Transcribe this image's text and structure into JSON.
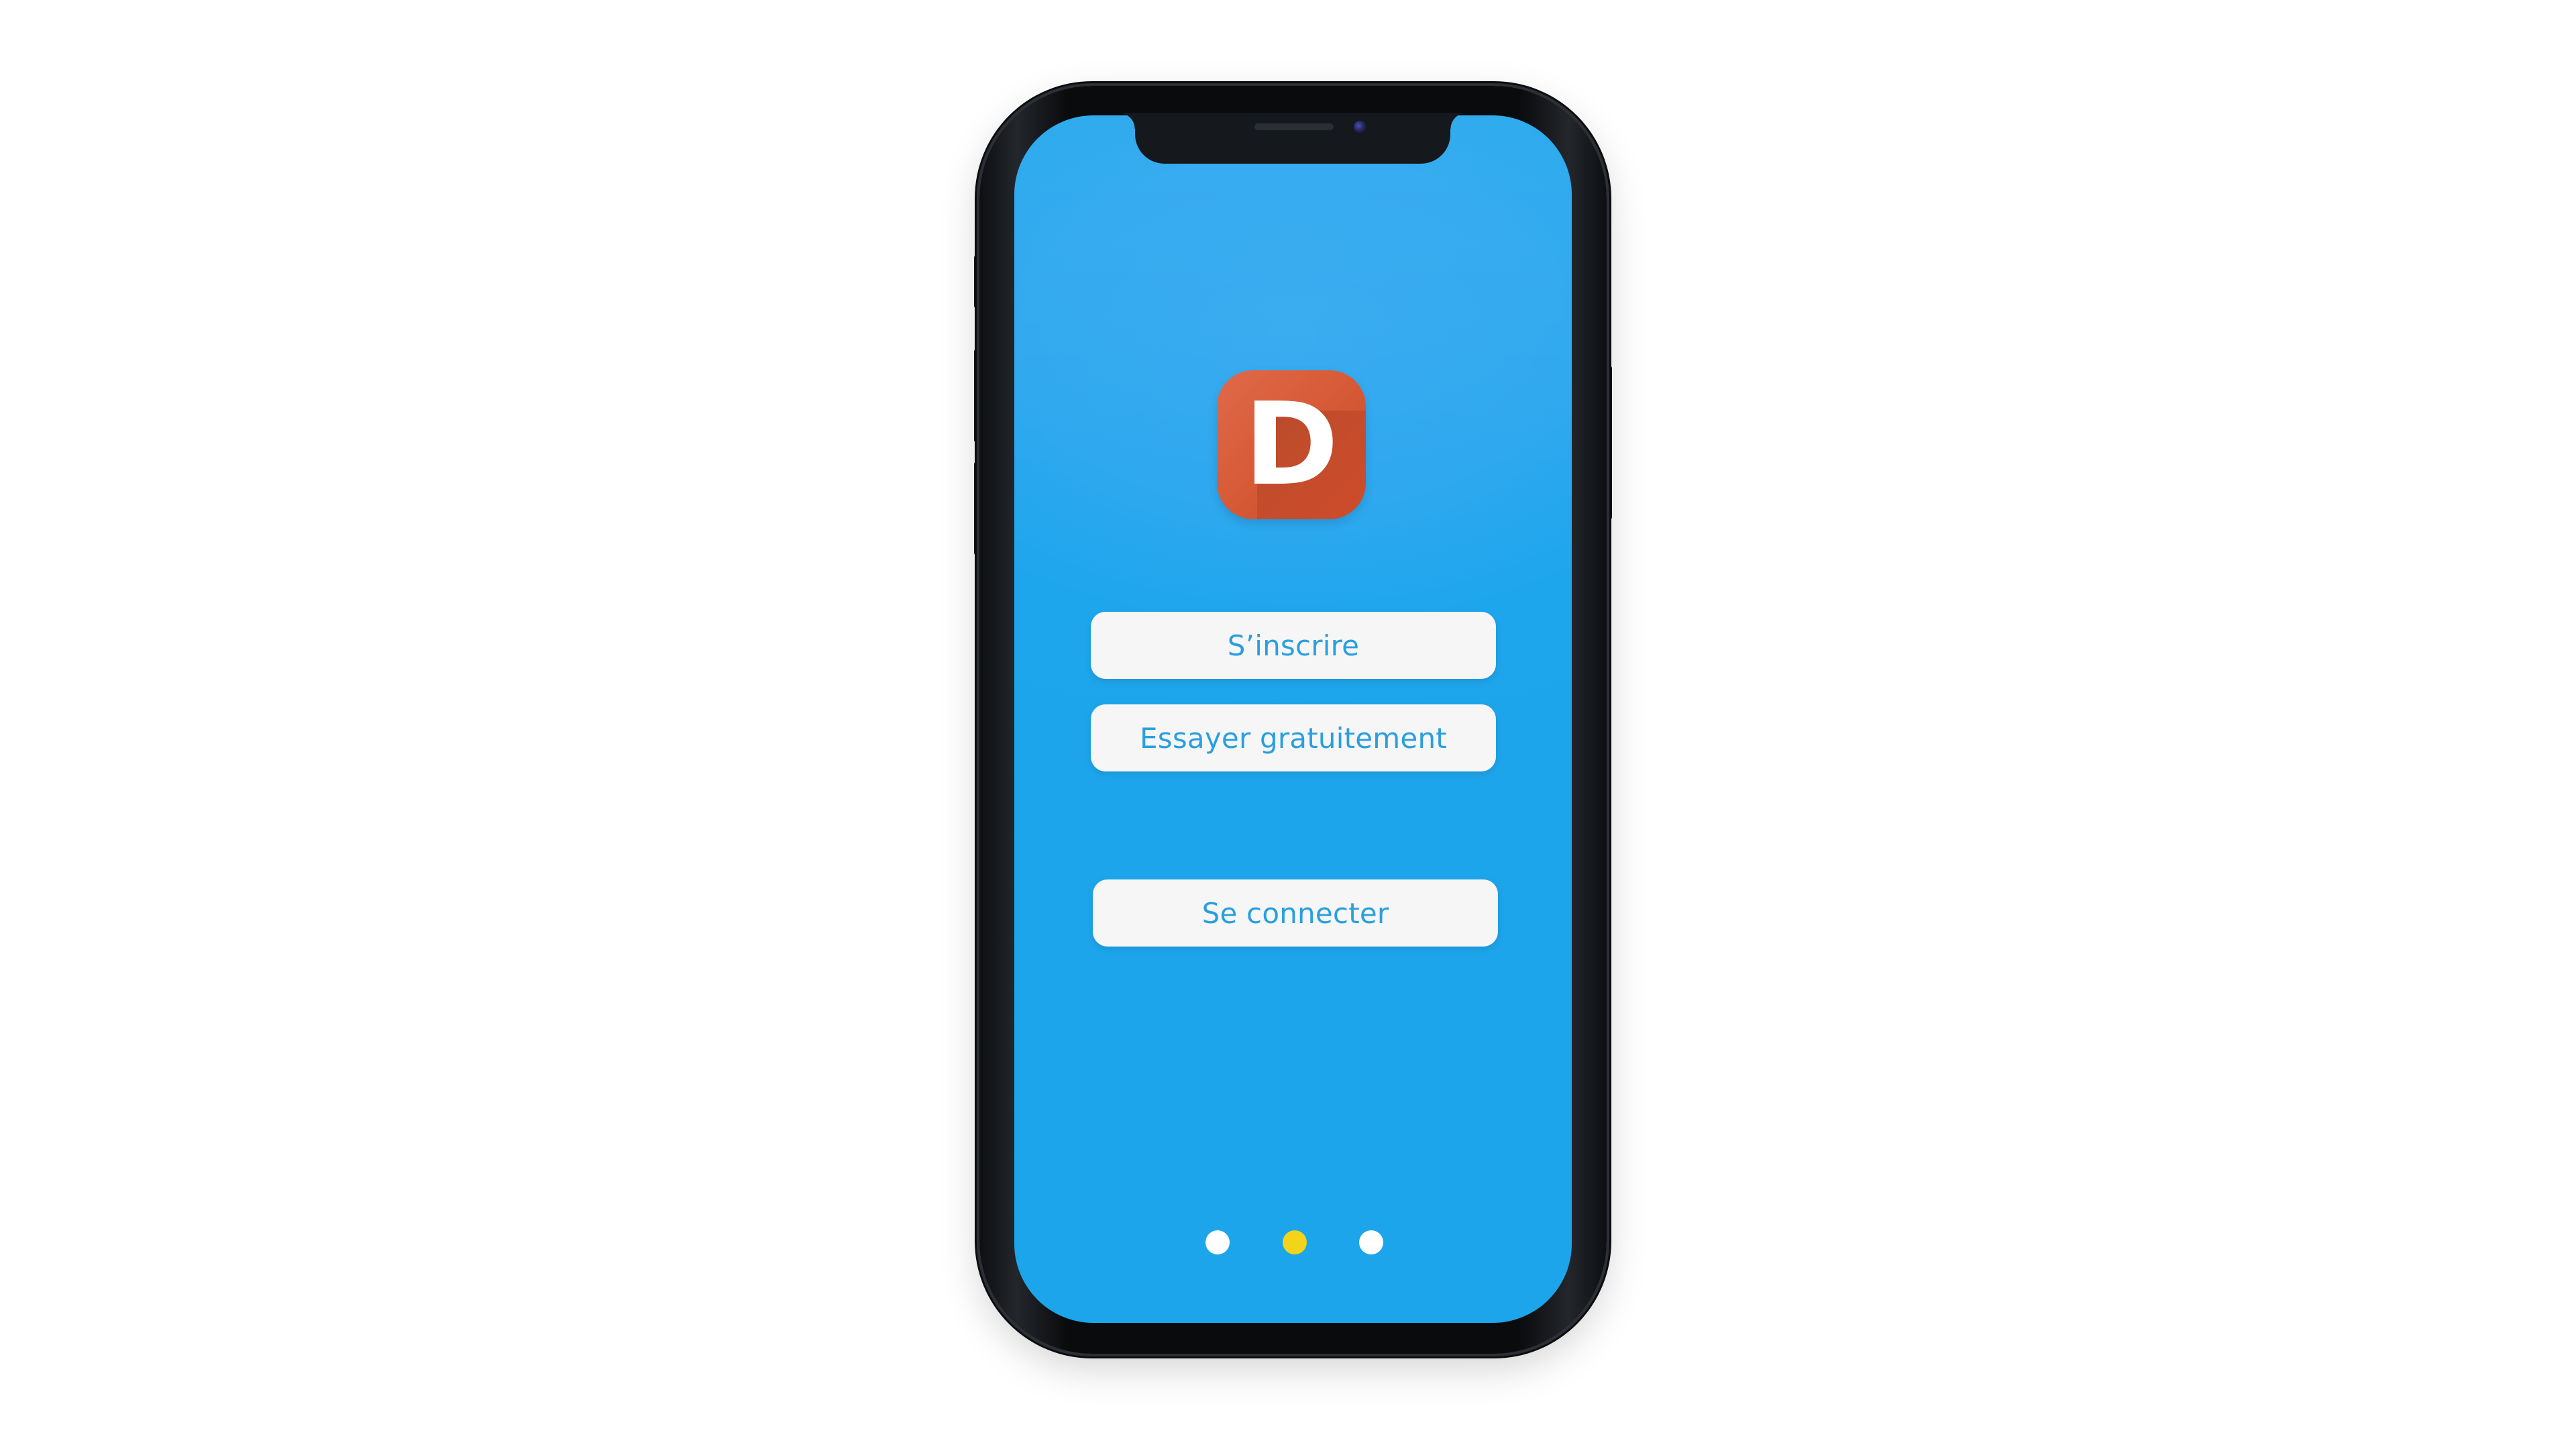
{
  "app": {
    "logo_letter": "D",
    "logo_color": "#d65a36"
  },
  "buttons": {
    "signup_label": "S’inscrire",
    "try_label": "Essayer gratuitement",
    "login_label": "Se connecter"
  },
  "pagination": {
    "total_pages": 3,
    "active_page": 2,
    "active_color": "#f3d41a",
    "inactive_color": "#ffffff"
  },
  "theme": {
    "screen_background": "#1da5eb",
    "button_background": "#f6f6f6",
    "button_text_color": "#2a9fdf"
  }
}
